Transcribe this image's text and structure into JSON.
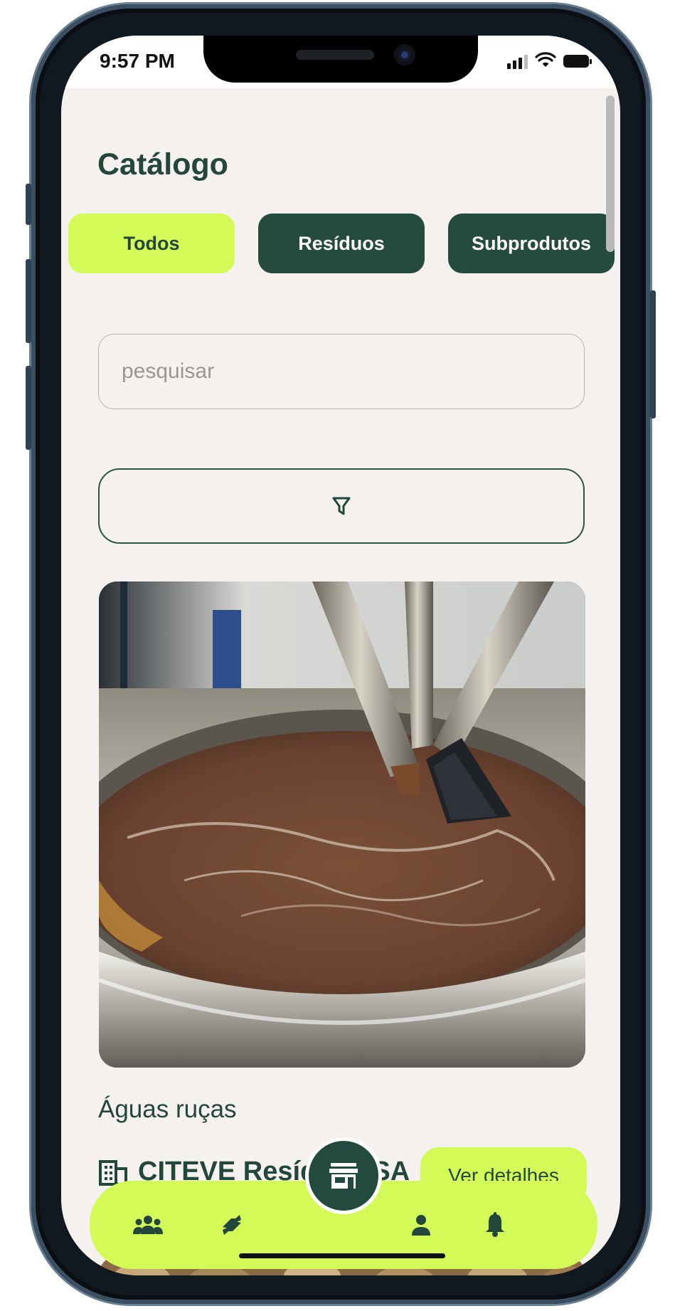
{
  "status_bar": {
    "time": "9:57 PM"
  },
  "catalog": {
    "title": "Catálogo",
    "tabs": [
      {
        "label": "Todos",
        "active": true
      },
      {
        "label": "Resíduos",
        "active": false
      },
      {
        "label": "Subprodutos",
        "active": false
      }
    ],
    "search": {
      "placeholder": "pesquisar",
      "value": ""
    },
    "filter_icon": "filter-icon"
  },
  "item": {
    "image_description": "olive mill wastewater in steel tank",
    "title": "Águas ruças",
    "company": "CITEVE Resíduos SA",
    "company_icon": "building-icon",
    "details_label": "Ver detalhes"
  },
  "bottom_nav": {
    "items": [
      "community-icon",
      "exchange-icon",
      "store-icon",
      "profile-icon",
      "bell-icon"
    ],
    "active": "store-icon"
  },
  "colors": {
    "accent": "#d4fa58",
    "primary": "#254b3e",
    "background": "#f5f1ee"
  }
}
